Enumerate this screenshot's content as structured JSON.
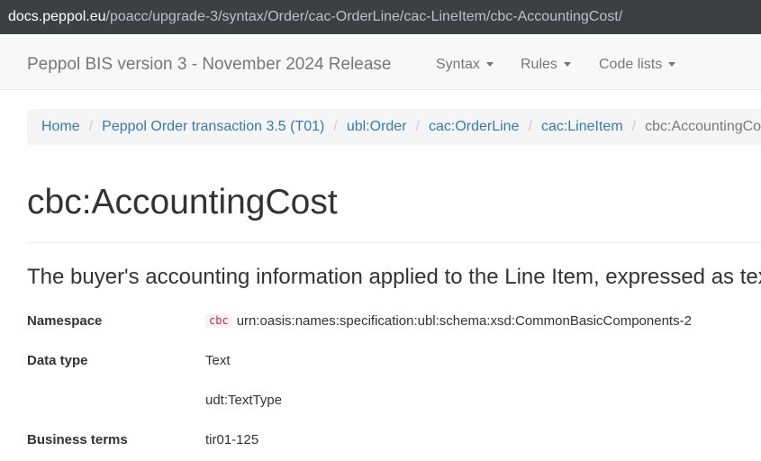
{
  "browser": {
    "url_domain": "docs.peppol.eu",
    "url_path": "/poacc/upgrade-3/syntax/Order/cac-OrderLine/cac-LineItem/cbc-AccountingCost/"
  },
  "navbar": {
    "brand": "Peppol BIS version 3 - November 2024 Release",
    "items": [
      {
        "label": "Syntax"
      },
      {
        "label": "Rules"
      },
      {
        "label": "Code lists"
      }
    ]
  },
  "breadcrumb": {
    "links": [
      {
        "label": "Home"
      },
      {
        "label": "Peppol Order transaction 3.5 (T01)"
      },
      {
        "label": "ubl:Order"
      },
      {
        "label": "cac:OrderLine"
      },
      {
        "label": "cac:LineItem"
      }
    ],
    "separator": "/",
    "current": "cbc:AccountingCost"
  },
  "page": {
    "title": "cbc:AccountingCost",
    "description": "The buyer's accounting information applied to the Line Item, expressed as text."
  },
  "details": {
    "namespace_label": "Namespace",
    "namespace_prefix": "cbc",
    "namespace_value": "urn:oasis:names:specification:ubl:schema:xsd:CommonBasicComponents-2",
    "data_type_label": "Data type",
    "data_type_values": [
      "Text",
      "udt:TextType"
    ],
    "business_terms_label": "Business terms",
    "business_terms_value": "tir01-125"
  }
}
